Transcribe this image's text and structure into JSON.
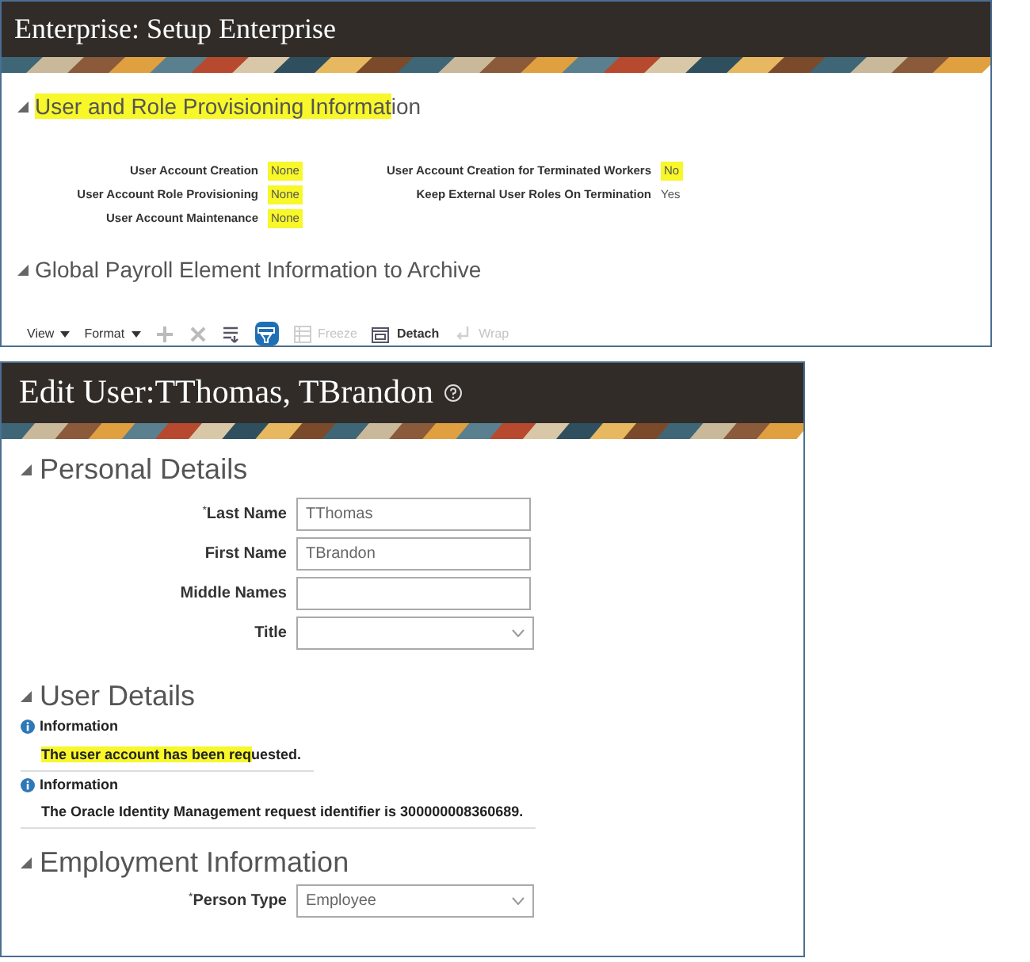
{
  "setup_panel": {
    "title": "Enterprise: Setup Enterprise",
    "section": {
      "expanded": true,
      "heading": [
        {
          "text": "User and Role Provisioning Informat",
          "highlighted": true
        },
        {
          "text": "ion",
          "highlighted": false
        }
      ],
      "left_fields": [
        {
          "label": "User Account Creation",
          "value": "None",
          "highlighted": true
        },
        {
          "label": "User Account Role Provisioning",
          "value": "None",
          "highlighted": true
        },
        {
          "label": "User Account Maintenance",
          "value": "None",
          "highlighted": true
        }
      ],
      "right_fields": [
        {
          "label": "User Account Creation for Terminated Workers",
          "value": "No",
          "highlighted": true
        },
        {
          "label": "Keep External User Roles On Termination",
          "value": "Yes",
          "highlighted": false
        }
      ]
    },
    "section_2": {
      "expanded": true,
      "heading": "Global Payroll Element Information to Archive"
    },
    "toolbar": [
      {
        "kind": "menu",
        "label": "View",
        "disabled": false
      },
      {
        "kind": "menu",
        "label": "Format",
        "disabled": false
      },
      {
        "kind": "add",
        "disabled": true
      },
      {
        "kind": "delete",
        "disabled": true
      },
      {
        "kind": "columns",
        "disabled": false
      },
      {
        "kind": "filter",
        "selected": true,
        "disabled": false
      },
      {
        "kind": "freeze",
        "label": "Freeze",
        "disabled": true
      },
      {
        "kind": "detach",
        "label": "Detach",
        "disabled": false
      },
      {
        "kind": "wrap",
        "label": "Wrap",
        "disabled": true
      }
    ]
  },
  "edit_panel": {
    "title": "Edit User:TThomas, TBrandon",
    "personal": {
      "heading": "Personal Details",
      "expanded": true,
      "fields": [
        {
          "kind": "text",
          "required_mark": "*",
          "label": "Last Name",
          "value": "TThomas"
        },
        {
          "kind": "text",
          "label": "First Name",
          "value": "TBrandon"
        },
        {
          "kind": "text",
          "label": "Middle Names"
        },
        {
          "kind": "select",
          "label": "Title"
        }
      ]
    },
    "user_details": {
      "heading": "User Details",
      "expanded": true,
      "messages": [
        {
          "title": "Information",
          "text": [
            {
              "text": "The user account has been req",
              "highlighted": true
            },
            {
              "text": "uested.",
              "highlighted": false
            }
          ]
        },
        {
          "title": "Information",
          "text": [
            {
              "text": "The Oracle Identity Management request identifier is 300000008360689.",
              "highlighted": false
            }
          ]
        }
      ]
    },
    "employment": {
      "heading": "Employment Information",
      "expanded": true,
      "fields": [
        {
          "kind": "select",
          "required_mark": "*",
          "label": "Person Type",
          "value": "Employee"
        }
      ]
    }
  }
}
